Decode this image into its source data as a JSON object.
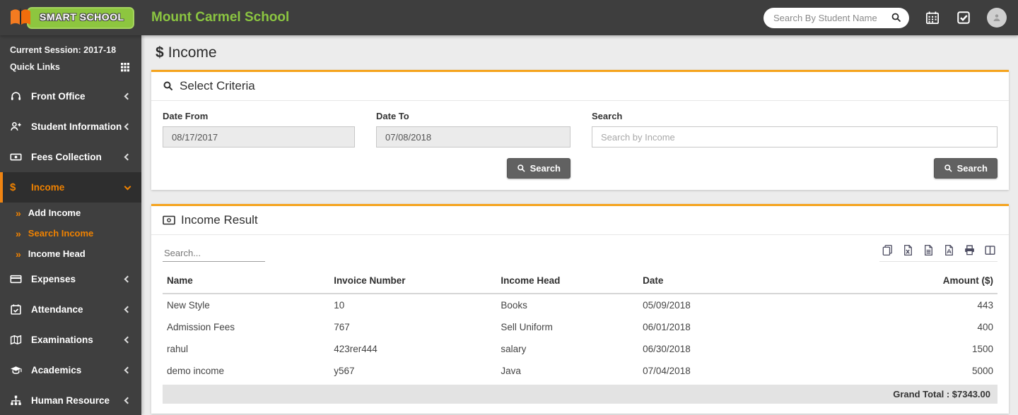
{
  "header": {
    "brand": "SMART SCHOOL",
    "school_name": "Mount Carmel School",
    "search_placeholder": "Search By Student Name"
  },
  "sidebar": {
    "session": "Current Session: 2017-18",
    "quick_links": "Quick Links",
    "items": [
      "Front Office",
      "Student Information",
      "Fees Collection",
      "Income",
      "Expenses",
      "Attendance",
      "Examinations",
      "Academics",
      "Human Resource"
    ],
    "income_submenu": [
      "Add Income",
      "Search Income",
      "Income Head"
    ],
    "active_item": "Income",
    "active_subitem": "Search Income"
  },
  "page": {
    "dollar_icon": "$",
    "title": "Income"
  },
  "criteria": {
    "panel_title": "Select Criteria",
    "date_from_label": "Date From",
    "date_from_value": "08/17/2017",
    "date_to_label": "Date To",
    "date_to_value": "07/08/2018",
    "search_label": "Search",
    "search_placeholder": "Search by Income",
    "search_button_label": "Search"
  },
  "results": {
    "panel_title": "Income Result",
    "table_search_placeholder": "Search...",
    "export_buttons": [
      "copy",
      "excel",
      "csv",
      "pdf",
      "print",
      "columns"
    ],
    "columns": [
      "Name",
      "Invoice Number",
      "Income Head",
      "Date",
      "Amount ($)"
    ],
    "rows": [
      [
        "New Style",
        "10",
        "Books",
        "05/09/2018",
        "443"
      ],
      [
        "Admission Fees",
        "767",
        "Sell Uniform",
        "06/01/2018",
        "400"
      ],
      [
        "rahul",
        "423rer444",
        "salary",
        "06/30/2018",
        "1500"
      ],
      [
        "demo income",
        "y567",
        "Java",
        "07/04/2018",
        "5000"
      ]
    ],
    "grand_total": "Grand Total : $7343.00"
  },
  "icons": {
    "double_arrow": "»"
  },
  "colors": {
    "topbar_bg": "#3e3e3e",
    "sidebar_bg": "#3f3f3f",
    "accent_orange": "#f08200",
    "panel_border_orange": "#f5a31c",
    "brand_green": "#8dc63f",
    "school_name_green": "#8bc541",
    "content_bg": "#ececec",
    "button_gray": "#616161",
    "grand_total_bg": "#e3e3e3"
  }
}
